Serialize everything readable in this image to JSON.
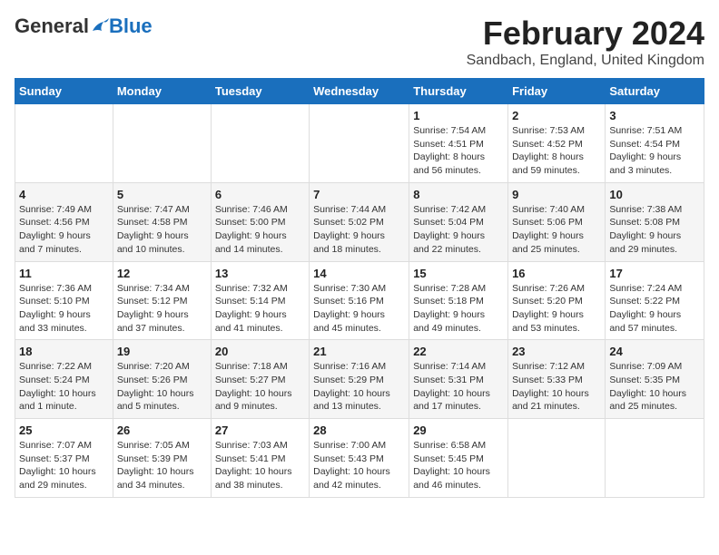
{
  "logo": {
    "general": "General",
    "blue": "Blue"
  },
  "title": "February 2024",
  "location": "Sandbach, England, United Kingdom",
  "headers": [
    "Sunday",
    "Monday",
    "Tuesday",
    "Wednesday",
    "Thursday",
    "Friday",
    "Saturday"
  ],
  "weeks": [
    [
      {
        "day": "",
        "info": ""
      },
      {
        "day": "",
        "info": ""
      },
      {
        "day": "",
        "info": ""
      },
      {
        "day": "",
        "info": ""
      },
      {
        "day": "1",
        "info": "Sunrise: 7:54 AM\nSunset: 4:51 PM\nDaylight: 8 hours\nand 56 minutes."
      },
      {
        "day": "2",
        "info": "Sunrise: 7:53 AM\nSunset: 4:52 PM\nDaylight: 8 hours\nand 59 minutes."
      },
      {
        "day": "3",
        "info": "Sunrise: 7:51 AM\nSunset: 4:54 PM\nDaylight: 9 hours\nand 3 minutes."
      }
    ],
    [
      {
        "day": "4",
        "info": "Sunrise: 7:49 AM\nSunset: 4:56 PM\nDaylight: 9 hours\nand 7 minutes."
      },
      {
        "day": "5",
        "info": "Sunrise: 7:47 AM\nSunset: 4:58 PM\nDaylight: 9 hours\nand 10 minutes."
      },
      {
        "day": "6",
        "info": "Sunrise: 7:46 AM\nSunset: 5:00 PM\nDaylight: 9 hours\nand 14 minutes."
      },
      {
        "day": "7",
        "info": "Sunrise: 7:44 AM\nSunset: 5:02 PM\nDaylight: 9 hours\nand 18 minutes."
      },
      {
        "day": "8",
        "info": "Sunrise: 7:42 AM\nSunset: 5:04 PM\nDaylight: 9 hours\nand 22 minutes."
      },
      {
        "day": "9",
        "info": "Sunrise: 7:40 AM\nSunset: 5:06 PM\nDaylight: 9 hours\nand 25 minutes."
      },
      {
        "day": "10",
        "info": "Sunrise: 7:38 AM\nSunset: 5:08 PM\nDaylight: 9 hours\nand 29 minutes."
      }
    ],
    [
      {
        "day": "11",
        "info": "Sunrise: 7:36 AM\nSunset: 5:10 PM\nDaylight: 9 hours\nand 33 minutes."
      },
      {
        "day": "12",
        "info": "Sunrise: 7:34 AM\nSunset: 5:12 PM\nDaylight: 9 hours\nand 37 minutes."
      },
      {
        "day": "13",
        "info": "Sunrise: 7:32 AM\nSunset: 5:14 PM\nDaylight: 9 hours\nand 41 minutes."
      },
      {
        "day": "14",
        "info": "Sunrise: 7:30 AM\nSunset: 5:16 PM\nDaylight: 9 hours\nand 45 minutes."
      },
      {
        "day": "15",
        "info": "Sunrise: 7:28 AM\nSunset: 5:18 PM\nDaylight: 9 hours\nand 49 minutes."
      },
      {
        "day": "16",
        "info": "Sunrise: 7:26 AM\nSunset: 5:20 PM\nDaylight: 9 hours\nand 53 minutes."
      },
      {
        "day": "17",
        "info": "Sunrise: 7:24 AM\nSunset: 5:22 PM\nDaylight: 9 hours\nand 57 minutes."
      }
    ],
    [
      {
        "day": "18",
        "info": "Sunrise: 7:22 AM\nSunset: 5:24 PM\nDaylight: 10 hours\nand 1 minute."
      },
      {
        "day": "19",
        "info": "Sunrise: 7:20 AM\nSunset: 5:26 PM\nDaylight: 10 hours\nand 5 minutes."
      },
      {
        "day": "20",
        "info": "Sunrise: 7:18 AM\nSunset: 5:27 PM\nDaylight: 10 hours\nand 9 minutes."
      },
      {
        "day": "21",
        "info": "Sunrise: 7:16 AM\nSunset: 5:29 PM\nDaylight: 10 hours\nand 13 minutes."
      },
      {
        "day": "22",
        "info": "Sunrise: 7:14 AM\nSunset: 5:31 PM\nDaylight: 10 hours\nand 17 minutes."
      },
      {
        "day": "23",
        "info": "Sunrise: 7:12 AM\nSunset: 5:33 PM\nDaylight: 10 hours\nand 21 minutes."
      },
      {
        "day": "24",
        "info": "Sunrise: 7:09 AM\nSunset: 5:35 PM\nDaylight: 10 hours\nand 25 minutes."
      }
    ],
    [
      {
        "day": "25",
        "info": "Sunrise: 7:07 AM\nSunset: 5:37 PM\nDaylight: 10 hours\nand 29 minutes."
      },
      {
        "day": "26",
        "info": "Sunrise: 7:05 AM\nSunset: 5:39 PM\nDaylight: 10 hours\nand 34 minutes."
      },
      {
        "day": "27",
        "info": "Sunrise: 7:03 AM\nSunset: 5:41 PM\nDaylight: 10 hours\nand 38 minutes."
      },
      {
        "day": "28",
        "info": "Sunrise: 7:00 AM\nSunset: 5:43 PM\nDaylight: 10 hours\nand 42 minutes."
      },
      {
        "day": "29",
        "info": "Sunrise: 6:58 AM\nSunset: 5:45 PM\nDaylight: 10 hours\nand 46 minutes."
      },
      {
        "day": "",
        "info": ""
      },
      {
        "day": "",
        "info": ""
      }
    ]
  ]
}
